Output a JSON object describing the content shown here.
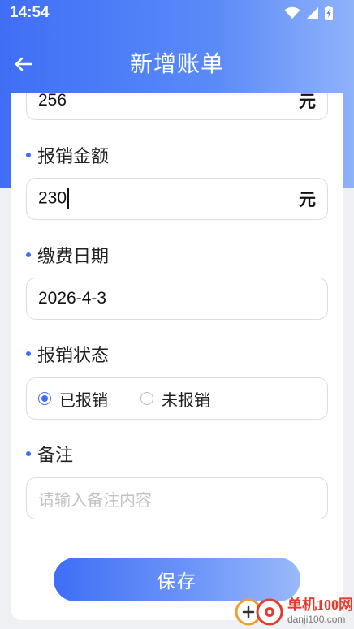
{
  "status_bar": {
    "time": "14:54",
    "icons": [
      "wifi-icon",
      "signal-icon",
      "battery-charging-icon"
    ]
  },
  "app_bar": {
    "back_icon": "arrow-left-icon",
    "title": "新增账单"
  },
  "form": {
    "amount_field": {
      "value": "256",
      "unit": "元"
    },
    "reimburse_amount": {
      "label": "报销金额",
      "value": "230",
      "unit": "元"
    },
    "payment_date": {
      "label": "缴费日期",
      "value": "2026-4-3"
    },
    "reimburse_status": {
      "label": "报销状态",
      "options": [
        {
          "label": "已报销",
          "checked": true
        },
        {
          "label": "未报销",
          "checked": false
        }
      ]
    },
    "remark": {
      "label": "备注",
      "placeholder": "请输入备注内容",
      "value": ""
    }
  },
  "save_button": {
    "label": "保存"
  },
  "watermark": {
    "title": "单机100网",
    "domain": "danji100.com"
  },
  "colors": {
    "accent": "#3f6ef6",
    "card": "#ffffff",
    "background": "#eef0f4"
  }
}
